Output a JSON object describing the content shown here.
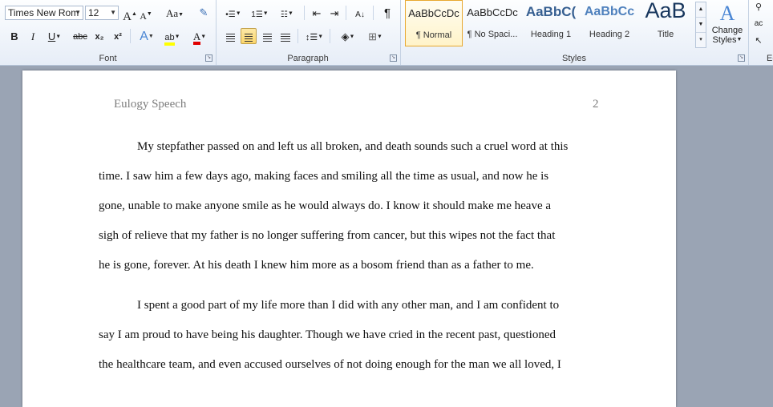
{
  "font": {
    "name": "Times New Rom",
    "size": "12",
    "grow_icon": "A",
    "shrink_icon": "A",
    "case_label": "Aa",
    "bold": "B",
    "italic": "I",
    "underline": "U",
    "strike": "abc",
    "subscript": "x₂",
    "superscript": "x²",
    "effects": "A",
    "highlight": "ab",
    "color": "A",
    "group_label": "Font"
  },
  "paragraph": {
    "group_label": "Paragraph",
    "pilcrow": "¶"
  },
  "styles": {
    "group_label": "Styles",
    "items": [
      {
        "sample": "AaBbCcDc",
        "name": "¶ Normal"
      },
      {
        "sample": "AaBbCcDc",
        "name": "¶ No Spaci..."
      },
      {
        "sample": "AaBbC(",
        "name": "Heading 1"
      },
      {
        "sample": "AaBbCc",
        "name": "Heading 2"
      },
      {
        "sample": "AaB",
        "name": "Title"
      }
    ],
    "change_styles_line1": "Change",
    "change_styles_line2": "Styles"
  },
  "editing": {
    "group_label": "Ed"
  },
  "colors": {
    "accent": "#e8a830",
    "heading": "#365f91",
    "highlight": "#ffff00",
    "font_color": "#e00000"
  },
  "document": {
    "header_title": "Eulogy Speech",
    "page_number": "2",
    "lines": [
      "My stepfather passed on and left us all broken, and death sounds such a cruel word at this",
      "time. I saw him a few days ago, making faces and smiling all the time as usual, and now he is",
      "gone, unable to make anyone smile as he would always do. I know it should make me heave a",
      "sigh of relieve that my father is no longer suffering from cancer, but this wipes not the fact that",
      "he is gone, forever. At his death I knew him more as a bosom friend than as a father to me.",
      "I spent a good part of my life more than I did with any other man, and I am confident to",
      "say I am proud to have being his daughter. Though we have cried in the recent past, questioned",
      "the healthcare team, and even accused ourselves of not doing enough for the man we all loved, I"
    ]
  }
}
